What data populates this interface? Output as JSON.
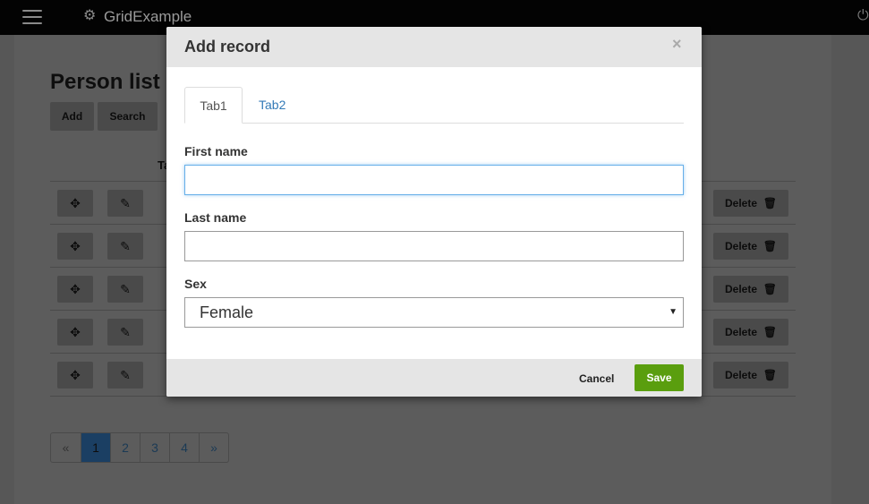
{
  "navbar": {
    "menu_icon": "hamburger-menu-icon",
    "brand_icon": "gear-icon",
    "brand": "GridExample",
    "power_icon": "power-icon"
  },
  "page": {
    "title": "Person list",
    "add_label": "Add",
    "search_label": "Search",
    "column_header_partial": "Ta",
    "row_icons": {
      "move": "move-icon",
      "edit": "edit-icon",
      "delete": "trash-icon"
    },
    "rows": [
      {
        "delete_label": "Delete"
      },
      {
        "delete_label": "Delete"
      },
      {
        "delete_label": "Delete"
      },
      {
        "delete_label": "Delete"
      },
      {
        "delete_label": "Delete"
      }
    ],
    "pagination": {
      "prev": "«",
      "pages": [
        "1",
        "2",
        "3",
        "4"
      ],
      "next": "»",
      "active": "1"
    }
  },
  "modal": {
    "title": "Add record",
    "close": "×",
    "tabs": [
      {
        "label": "Tab1",
        "active": true
      },
      {
        "label": "Tab2",
        "active": false
      }
    ],
    "first_name": {
      "label": "First name",
      "value": ""
    },
    "last_name": {
      "label": "Last name",
      "value": ""
    },
    "sex": {
      "label": "Sex",
      "selected": "Female"
    },
    "cancel_label": "Cancel",
    "save_label": "Save"
  },
  "colors": {
    "navbar_bg": "#030303",
    "overlay_bg": "#575757",
    "save_button": "#5a9e0e",
    "link": "#337ab7",
    "focus_border": "#66afe9"
  }
}
